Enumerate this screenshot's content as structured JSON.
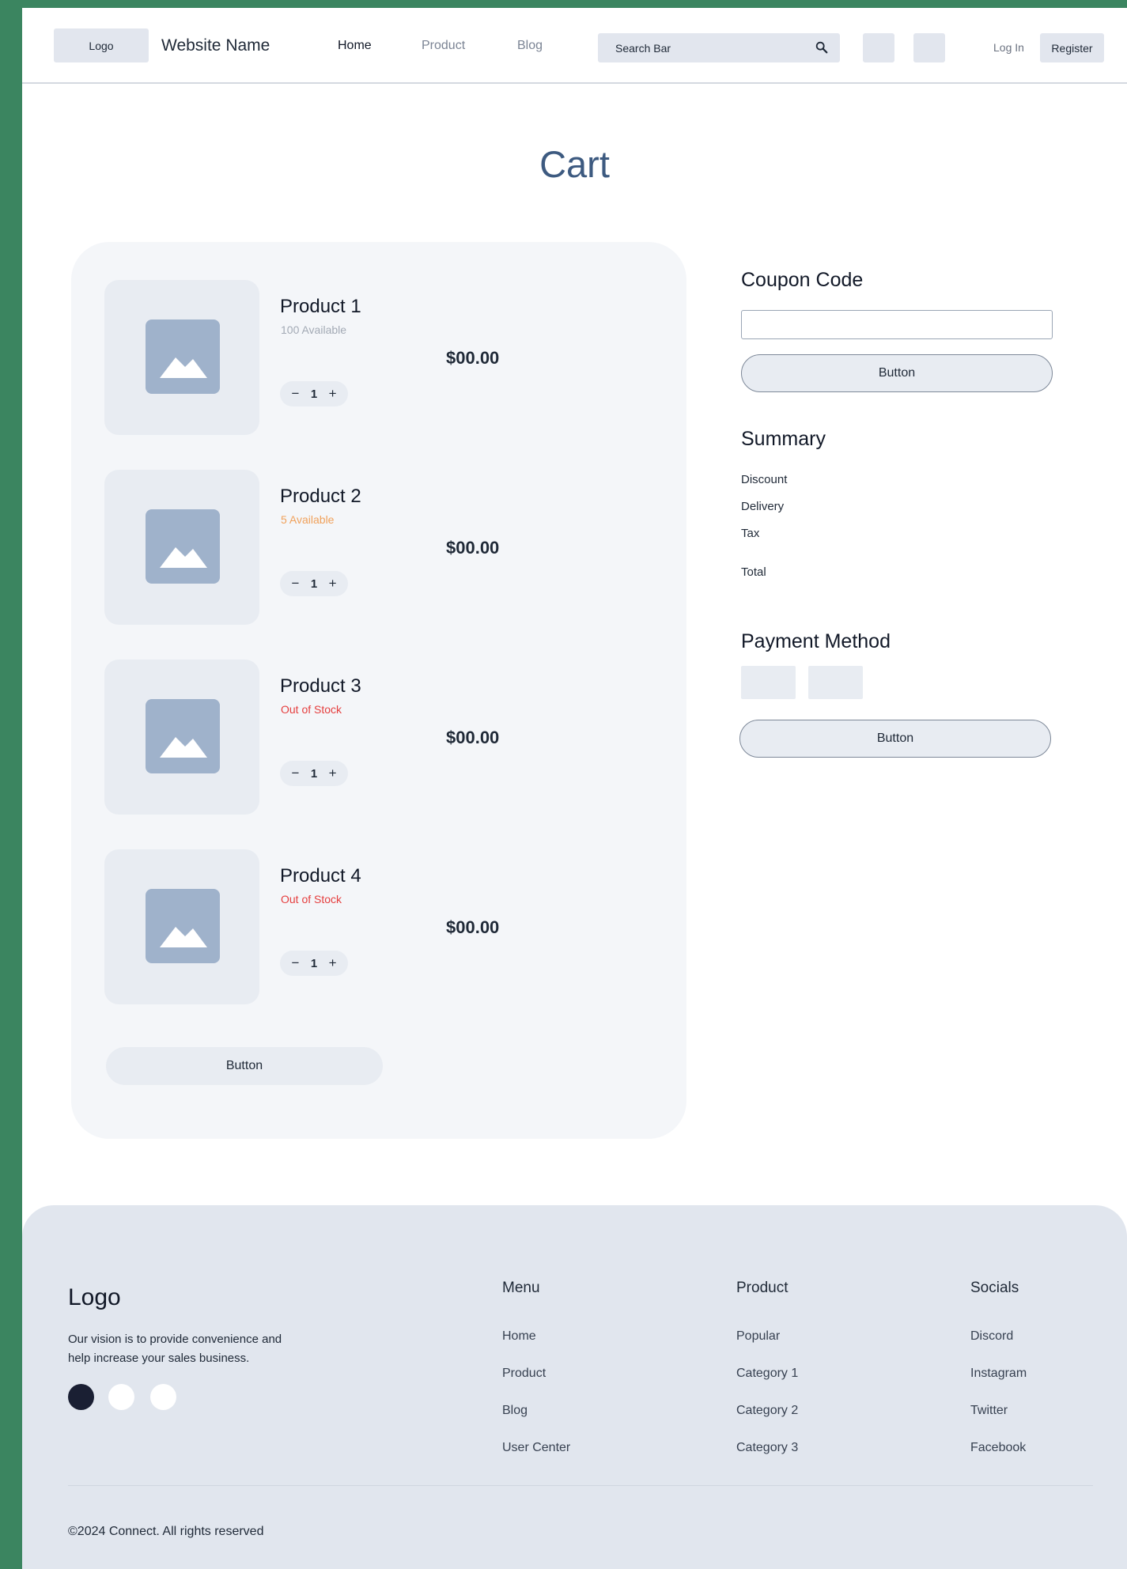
{
  "header": {
    "logo_label": "Logo",
    "site_name": "Website Name",
    "nav": [
      "Home",
      "Product",
      "Blog"
    ],
    "active_nav": "Home",
    "search_placeholder": "Search Bar",
    "login_label": "Log In",
    "register_label": "Register"
  },
  "page_title": "Cart",
  "cart": {
    "items": [
      {
        "name": "Product 1",
        "availability": "100 Available",
        "availability_color": "#a3aab5",
        "price": "$00.00",
        "quantity": "1"
      },
      {
        "name": "Product 2",
        "availability": "5 Available",
        "availability_color": "#f0a15b",
        "price": "$00.00",
        "quantity": "1"
      },
      {
        "name": "Product 3",
        "availability": "Out of Stock",
        "availability_color": "#e53e3e",
        "price": "$00.00",
        "quantity": "1"
      },
      {
        "name": "Product 4",
        "availability": "Out of Stock",
        "availability_color": "#e53e3e",
        "price": "$00.00",
        "quantity": "1"
      }
    ],
    "button_label": "Button"
  },
  "coupon": {
    "heading": "Coupon Code",
    "button_label": "Button"
  },
  "summary": {
    "heading": "Summary",
    "rows": [
      "Discount",
      "Delivery",
      "Tax",
      "Total"
    ]
  },
  "payment": {
    "heading": "Payment Method",
    "button_label": "Button"
  },
  "footer": {
    "logo": "Logo",
    "vision": "Our vision is to provide convenience and help increase your sales business.",
    "social_dot_colors": [
      "#1a1f33",
      "#ffffff",
      "#ffffff"
    ],
    "columns": [
      {
        "title": "Menu",
        "links": [
          "Home",
          "Product",
          "Blog",
          "User Center"
        ]
      },
      {
        "title": "Product",
        "links": [
          "Popular",
          "Category 1",
          "Category 2",
          "Category 3"
        ]
      },
      {
        "title": "Socials",
        "links": [
          "Discord",
          "Instagram",
          "Twitter",
          "Facebook"
        ]
      }
    ],
    "copyright": "©2024 Connect. All rights reserved"
  }
}
